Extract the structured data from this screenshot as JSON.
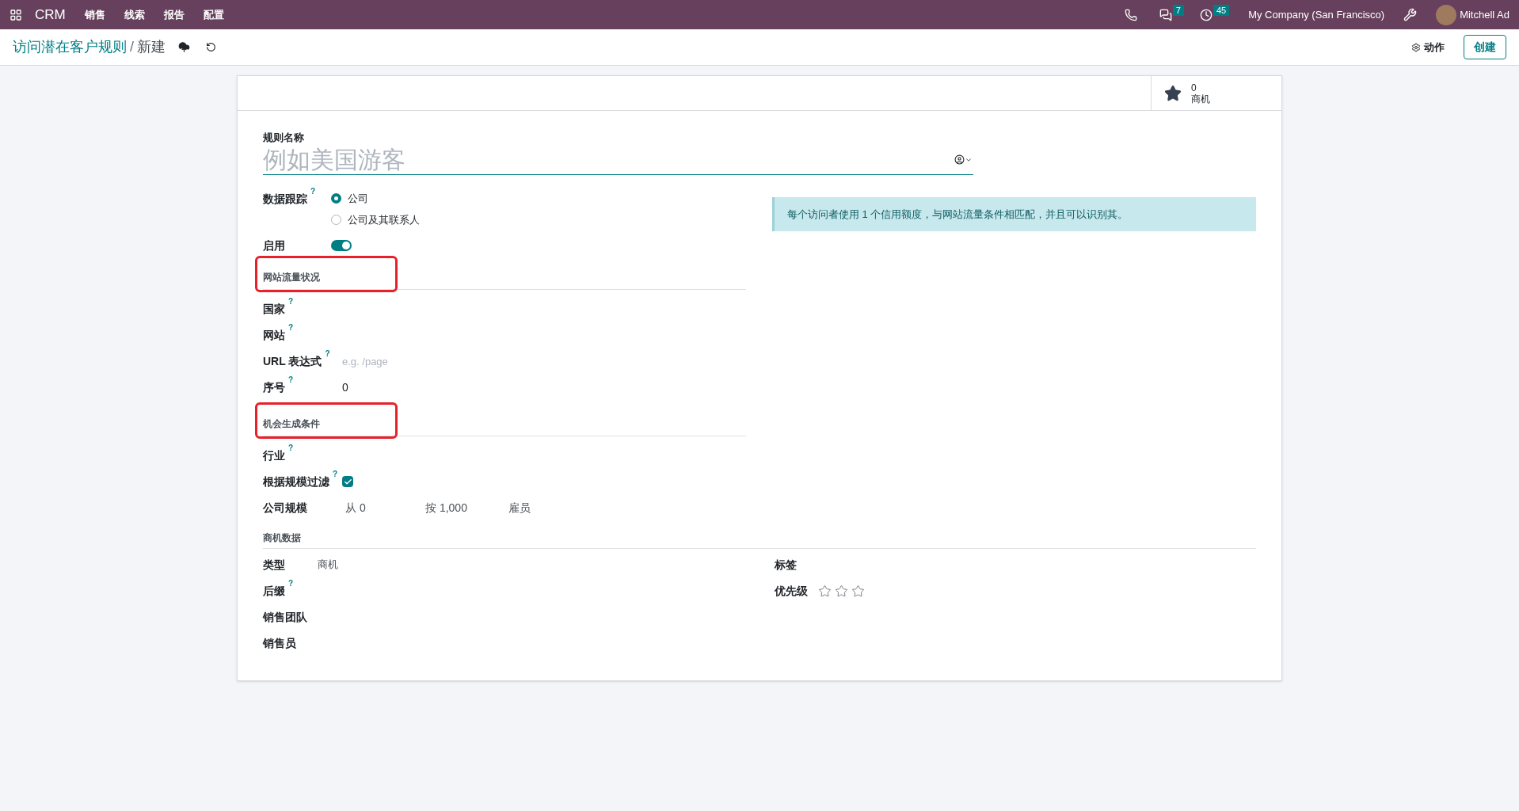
{
  "navbar": {
    "app": "CRM",
    "menus": [
      "销售",
      "线索",
      "报告",
      "配置"
    ],
    "messages_badge": "7",
    "activities_badge": "45",
    "company": "My Company (San Francisco)",
    "user": "Mitchell Ad"
  },
  "breadcrumb": {
    "parent": "访问潜在客户规则",
    "separator": "/",
    "current": "新建"
  },
  "actions": {
    "action_menu": "动作",
    "create_button": "创建"
  },
  "smart_button": {
    "count": "0",
    "label": "商机"
  },
  "name_field": {
    "label": "规则名称",
    "placeholder": "例如美国游客"
  },
  "data_tracking": {
    "label": "数据跟踪",
    "help": "?",
    "options": [
      {
        "label": "公司",
        "selected": true
      },
      {
        "label": "公司及其联系人",
        "selected": false
      }
    ]
  },
  "info_alert": "每个访问者使用 1 个信用额度，与网站流量条件相匹配，并且可以识别其。",
  "enabled": {
    "label": "启用",
    "on": true
  },
  "sections": [
    {
      "title": "网站流量状况",
      "highlighted": true,
      "fields": [
        {
          "kind": "text",
          "label": "国家",
          "help": "?"
        },
        {
          "kind": "text",
          "label": "网站",
          "help": "?"
        },
        {
          "kind": "text",
          "label": "URL 表达式",
          "help": "?",
          "placeholder": "e.g. /page"
        },
        {
          "kind": "text",
          "label": "序号",
          "help": "?",
          "value": "0"
        }
      ]
    },
    {
      "title": "机会生成条件",
      "highlighted": true,
      "fields": [
        {
          "kind": "text",
          "label": "行业",
          "help": "?"
        },
        {
          "kind": "checkbox",
          "label": "根据规模过滤",
          "help": "?",
          "checked": true
        },
        {
          "kind": "range",
          "label": "公司规模",
          "from": "从 0",
          "to": "按 1,000",
          "unit": "雇员"
        }
      ]
    }
  ],
  "lead_data": {
    "title": "商机数据",
    "left": [
      {
        "label": "类型",
        "value": "商机"
      },
      {
        "label": "后缀",
        "help": "?"
      },
      {
        "label": "销售团队"
      },
      {
        "label": "销售员"
      }
    ],
    "right": [
      {
        "kind": "text",
        "label": "标签"
      },
      {
        "kind": "stars",
        "label": "优先级",
        "stars": 0
      }
    ]
  }
}
